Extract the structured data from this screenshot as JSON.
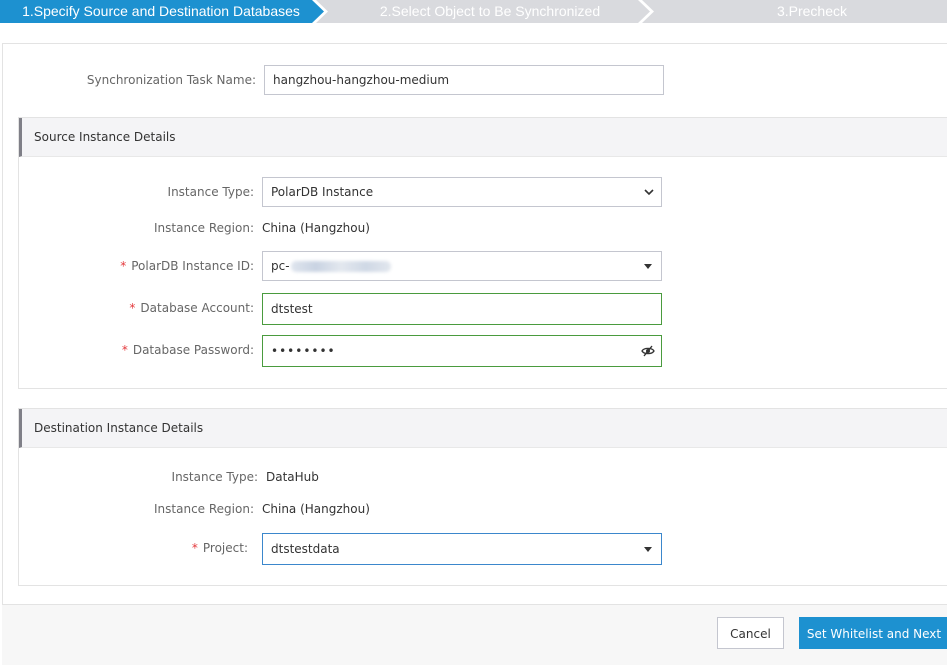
{
  "steps": [
    {
      "label": "1.Specify Source and Destination Databases",
      "state": "active"
    },
    {
      "label": "2.Select Object to Be Synchronized",
      "state": "pending"
    },
    {
      "label": "3.Precheck",
      "state": "pending"
    }
  ],
  "colors": {
    "active_step": "#1d91d0",
    "pending_step": "#d9dade",
    "primary_button": "#1d91d0",
    "required_mark": "#e4393c",
    "valid_border": "#4a9b3e",
    "focus_border": "#3b87cc"
  },
  "task": {
    "label": "Synchronization Task Name:",
    "value": "hangzhou-hangzhou-medium"
  },
  "source": {
    "title": "Source Instance Details",
    "instance_type": {
      "label": "Instance Type:",
      "value": "PolarDB Instance",
      "icon": "chevron-down-icon"
    },
    "instance_region": {
      "label": "Instance Region:",
      "value": "China (Hangzhou)"
    },
    "polardb_id": {
      "required": "*",
      "label": "PolarDB Instance ID:",
      "value_prefix": "pc-"
    },
    "account": {
      "required": "*",
      "label": "Database Account:",
      "value": "dtstest"
    },
    "password": {
      "required": "*",
      "label": "Database Password:",
      "value": "••••••••",
      "icon": "eye-slash-icon"
    }
  },
  "destination": {
    "title": "Destination Instance Details",
    "instance_type": {
      "label": "Instance Type:",
      "value": "DataHub"
    },
    "instance_region": {
      "label": "Instance Region:",
      "value": "China (Hangzhou)"
    },
    "project": {
      "required": "*",
      "label": "Project:",
      "value": "dtstestdata"
    }
  },
  "footer": {
    "cancel_label": "Cancel",
    "next_label": "Set Whitelist and Next"
  }
}
